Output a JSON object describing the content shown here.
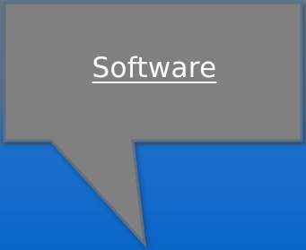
{
  "callout": {
    "label": "Software",
    "fill_color": "#808080",
    "border_color": "#5b6f86",
    "text_color": "#ffffff"
  },
  "background": {
    "color": "#0b6bcb"
  }
}
